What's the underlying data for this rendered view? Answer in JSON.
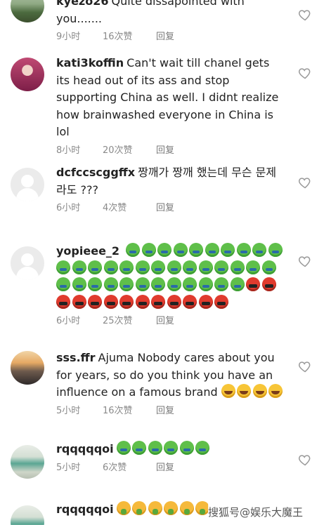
{
  "comments": [
    {
      "user": "kyezo26",
      "text": "Quite dissapointed with you.......",
      "time": "9小时",
      "likes": "16次赞",
      "reply": "回复",
      "avatar": "landscape-photo"
    },
    {
      "user": "kati3koffin",
      "text": "Can't wait till chanel gets its head out of its ass and stop supporting China as well. I didnt realize how brainwashed everyone in China is lol",
      "time": "8小时",
      "likes": "20次赞",
      "reply": "回复",
      "avatar": "girl-photo"
    },
    {
      "user": "dcfccscggffx",
      "text": "짱깨가 짱깨 했는데 무슨 문제라도 ???",
      "time": "6小时",
      "likes": "4次赞",
      "reply": "回复",
      "avatar": "default-avatar"
    },
    {
      "user": "yopieee_2",
      "text": "",
      "emojis": [
        "nauseated-face-emoji x36",
        "cursing-face-emoji x13"
      ],
      "time": "6小时",
      "likes": "25次赞",
      "reply": "回复",
      "avatar": "default-avatar"
    },
    {
      "user": "sss.ffr",
      "text": "Ajuma Nobody cares about you for years, so do you think you have an influence on a famous brand",
      "emojis": [
        "rolling-on-floor-laughing-emoji x4"
      ],
      "time": "5小时",
      "likes": "16次赞",
      "reply": "回复",
      "avatar": "sunset-photo"
    },
    {
      "user": "rqqqqqoi",
      "text": "",
      "emojis": [
        "nauseated-face-emoji x6"
      ],
      "time": "5小时",
      "likes": "6次赞",
      "reply": "回复",
      "avatar": "street-photo"
    },
    {
      "user": "rqqqqqoi",
      "text": "",
      "emojis": [
        "face-vomiting-emoji x6"
      ],
      "avatar": "street-photo"
    }
  ],
  "icons": {
    "like": "heart-outline-icon"
  },
  "colors": {
    "meta": "#8a8a8a",
    "heart": "#9a9a9a"
  },
  "watermark": "搜狐号@娱乐大魔王"
}
